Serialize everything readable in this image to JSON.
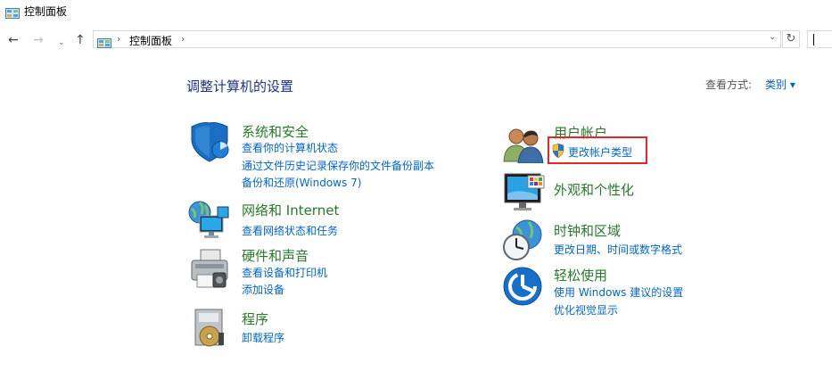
{
  "window": {
    "title": "控制面板"
  },
  "nav": {
    "back_icon": "←",
    "forward_icon": "→",
    "recent_icon": "⌄",
    "up_icon": "↑"
  },
  "address": {
    "separator": "›",
    "crumb": "控制面板",
    "dropdown_icon": "⌄"
  },
  "refresh_icon": "↻",
  "header": {
    "title": "调整计算机的设置",
    "view_label": "查看方式:",
    "view_value": "类别 ▾"
  },
  "categories": {
    "system": {
      "title": "系统和安全",
      "links": [
        "查看你的计算机状态",
        "通过文件历史记录保存你的文件备份副本",
        "备份和还原(Windows 7)"
      ]
    },
    "network": {
      "title": "网络和 Internet",
      "links": [
        "查看网络状态和任务"
      ]
    },
    "hardware": {
      "title": "硬件和声音",
      "links": [
        "查看设备和打印机",
        "添加设备"
      ]
    },
    "programs": {
      "title": "程序",
      "links": [
        "卸载程序"
      ]
    },
    "users": {
      "title": "用户帐户",
      "links": [
        "更改帐户类型"
      ]
    },
    "appearance": {
      "title": "外观和个性化",
      "links": []
    },
    "clock": {
      "title": "时钟和区域",
      "links": [
        "更改日期、时间或数字格式"
      ]
    },
    "ease": {
      "title": "轻松使用",
      "links": [
        "使用 Windows 建议的设置",
        "优化视觉显示"
      ]
    }
  },
  "colors": {
    "link": "#0066cc",
    "category_title": "#267a28",
    "page_title": "#1e3287",
    "highlight": "#e52727"
  }
}
